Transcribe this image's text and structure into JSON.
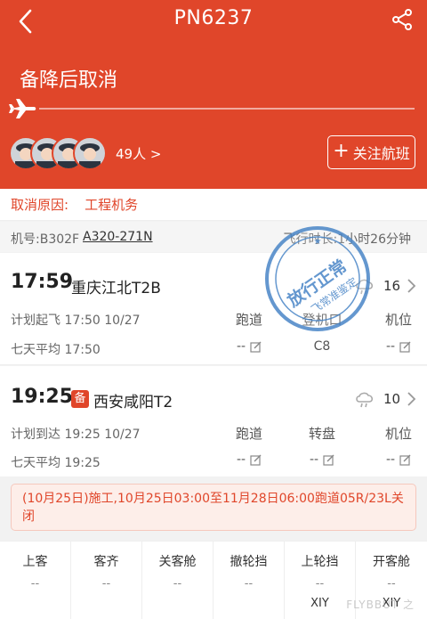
{
  "header": {
    "flight_no": "PN6237",
    "status": "备降后取消",
    "passenger_count_label": "49人 >",
    "follow_label": "关注航班",
    "bg_color": "#e0462a"
  },
  "cancel": {
    "label": "取消原因:",
    "value": "工程机务"
  },
  "info": {
    "registration": "机号:B302F",
    "model": "A320-271N",
    "duration": "飞行时长:1小时26分钟"
  },
  "departure": {
    "time": "17:59",
    "airport": "重庆江北T2B",
    "temp": "16",
    "weather_icon": "cloud-rain-icon",
    "plan_label": "计划起飞 17:50 10/27",
    "avg_label": "七天平均 17:50",
    "col_headers": [
      "跑道",
      "登机口",
      "机位"
    ],
    "col_values": [
      "--",
      "C8",
      "--"
    ]
  },
  "arrival": {
    "time": "19:25",
    "badge": "备",
    "airport": "西安咸阳T2",
    "temp": "10",
    "weather_icon": "cloud-rain-icon",
    "plan_label": "计划到达 19:25 10/27",
    "avg_label": "七天平均 19:25",
    "col_headers": [
      "跑道",
      "转盘",
      "机位"
    ],
    "col_values": [
      "--",
      "--",
      "--"
    ]
  },
  "notice": {
    "text": "(10月25日)施工,10月25日03:00至11月28日06:00跑道05R/23L关闭"
  },
  "stamp": {
    "line1": "放行正常",
    "line2": "飞常准鉴定"
  },
  "bottom": [
    {
      "label": "上客",
      "v1": "--",
      "v2": ""
    },
    {
      "label": "客齐",
      "v1": "--",
      "v2": ""
    },
    {
      "label": "关客舱",
      "v1": "--",
      "v2": ""
    },
    {
      "label": "撤轮挡",
      "v1": "--",
      "v2": ""
    },
    {
      "label": "上轮挡",
      "v1": "--",
      "v2": "XIY"
    },
    {
      "label": "开客舱",
      "v1": "--",
      "v2": "XIY"
    }
  ],
  "watermark": "FLYBBUT 之"
}
